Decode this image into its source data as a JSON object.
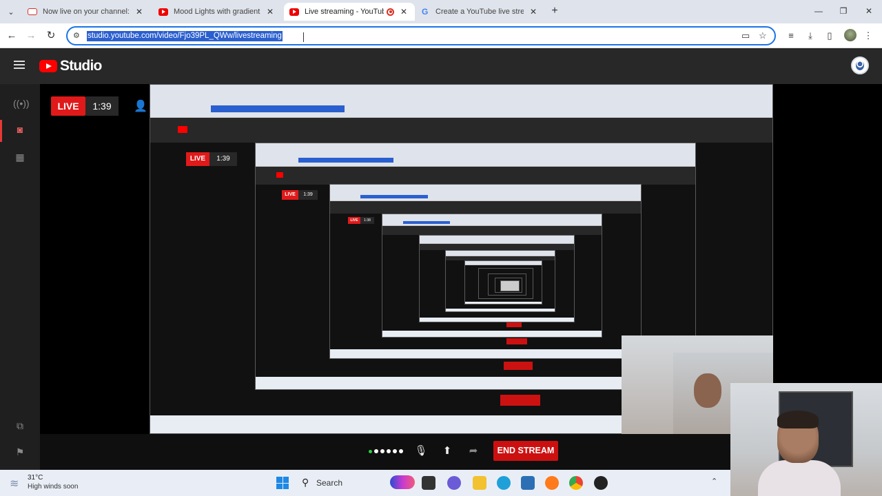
{
  "browser": {
    "tabs": [
      {
        "title": "Now live on your channel: JIMC",
        "icon": "gmail-icon"
      },
      {
        "title": "Mood Lights with gradient colo",
        "icon": "youtube-icon"
      },
      {
        "title": "Live streaming - YouTube St",
        "icon": "youtube-icon",
        "active": true
      },
      {
        "title": "Create a YouTube live stream w",
        "icon": "google-icon"
      }
    ],
    "url": "studio.youtube.com/video/Fjo39PL_QWw/livestreaming"
  },
  "studio": {
    "logo_text": "Studio",
    "live_label": "LIVE",
    "timer": "1:39",
    "end_stream_label": "END STREAM",
    "nested_live_label": "LIVE",
    "nested_timer_1": "1:39",
    "nested_timer_2": "1:39",
    "nested_timer_3": "1:38"
  },
  "taskbar": {
    "temperature": "31°C",
    "weather_desc": "High winds soon",
    "search_label": "Search"
  },
  "colors": {
    "accent_red": "#e01a1a",
    "url_highlight": "#2a5fcf",
    "live_dot_green": "#2ecc40"
  }
}
